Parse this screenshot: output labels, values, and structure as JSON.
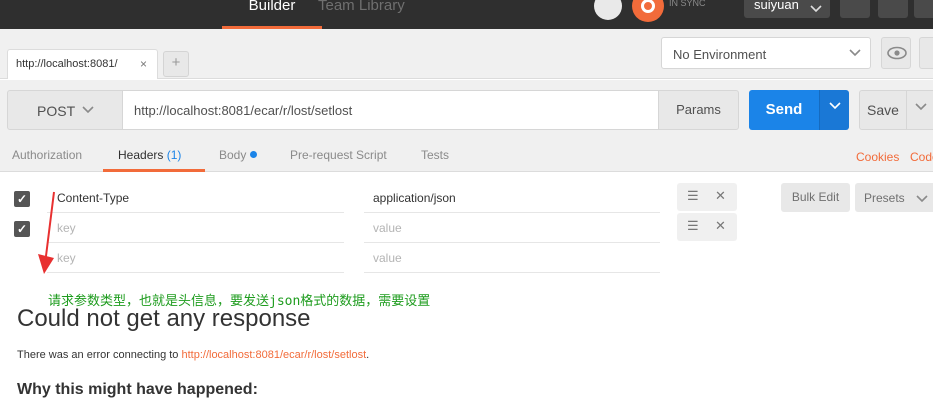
{
  "topbar": {
    "builder_tab": "Builder",
    "team_library_tab": "Team Library",
    "sync_status": "IN SYNC",
    "username": "suiyuan"
  },
  "request_tab": {
    "title": "http://localhost:8081/",
    "close": "×",
    "new_tab": "+"
  },
  "environment": {
    "selected": "No Environment"
  },
  "request": {
    "method": "POST",
    "url": "http://localhost:8081/ecar/r/lost/setlost",
    "params_label": "Params",
    "send_label": "Send",
    "save_label": "Save"
  },
  "subtabs": {
    "authorization": "Authorization",
    "headers": "Headers",
    "headers_count": "(1)",
    "body": "Body",
    "prerequest": "Pre-request Script",
    "tests": "Tests",
    "cookies": "Cookies",
    "code": "Code"
  },
  "headers_table": {
    "rows": [
      {
        "checked": true,
        "key": "Content-Type",
        "value": "application/json"
      },
      {
        "checked": true,
        "key_placeholder": "key",
        "value_placeholder": "value"
      },
      {
        "key_placeholder": "key",
        "value_placeholder": "value"
      }
    ],
    "bulk_edit": "Bulk Edit",
    "presets": "Presets"
  },
  "annotation": {
    "text": "请求参数类型，也就是头信息，要发送json格式的数据，需要设置",
    "color": "#1e9c1e",
    "arrow_color": "#e83030"
  },
  "response": {
    "title": "Could not get any response",
    "message_prefix": "There was an error connecting to ",
    "message_link": "http://localhost:8081/ecar/r/lost/setlost",
    "message_suffix": ".",
    "subheading": "Why this might have happened:"
  },
  "colors": {
    "accent_orange": "#f26b3a",
    "send_blue": "#1b84e8",
    "topbar_bg": "#2f2f2f"
  }
}
